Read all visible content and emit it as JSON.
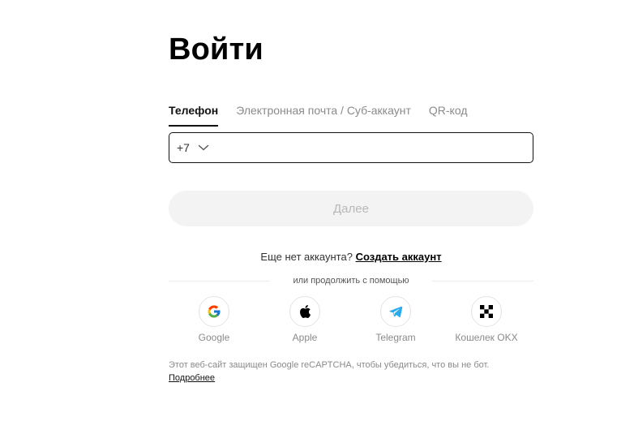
{
  "title": "Войти",
  "tabs": [
    {
      "label": "Телефон",
      "active": true
    },
    {
      "label": "Электронная почта / Суб-аккаунт",
      "active": false
    },
    {
      "label": "QR-код",
      "active": false
    }
  ],
  "phone": {
    "country_code": "+7",
    "value": "",
    "placeholder": ""
  },
  "next_button": {
    "label": "Далее",
    "disabled": true
  },
  "signup": {
    "prompt": "Еще нет аккаунта?",
    "link": "Создать аккаунт"
  },
  "divider_text": "или продолжить с помощью",
  "social": [
    {
      "label": "Google",
      "icon": "google-icon"
    },
    {
      "label": "Apple",
      "icon": "apple-icon"
    },
    {
      "label": "Telegram",
      "icon": "telegram-icon"
    },
    {
      "label": "Кошелек OKX",
      "icon": "okx-wallet-icon"
    }
  ],
  "recaptcha": {
    "text": "Этот веб-сайт защищен Google reCAPTCHA, чтобы убедиться, что вы не бот.",
    "link": "Подробнее"
  },
  "colors": {
    "text": "#121212",
    "muted": "#8a8a8a",
    "disabled_button_bg": "#f3f3f3",
    "telegram_blue": "#2aabee"
  }
}
